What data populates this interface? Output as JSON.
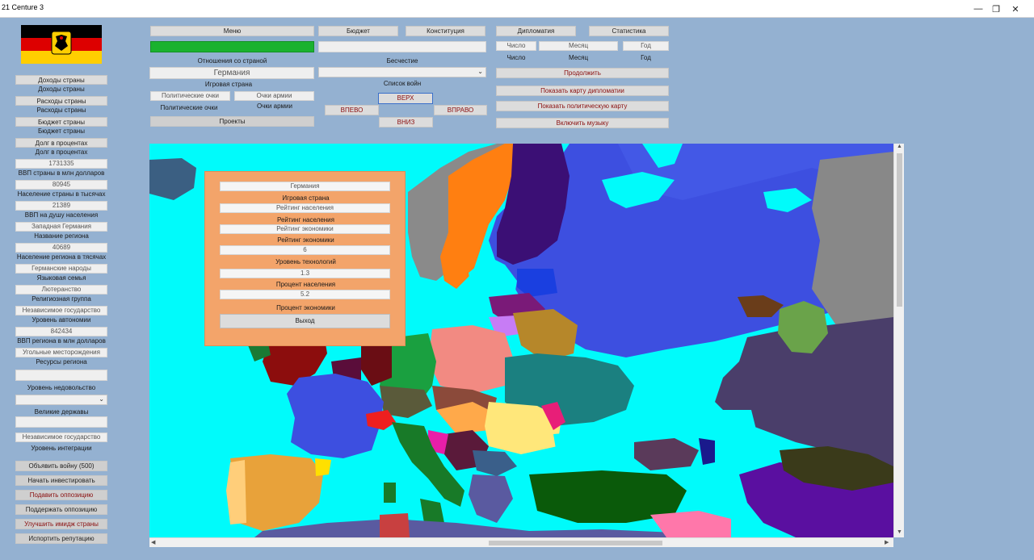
{
  "window": {
    "title": "21 Centure 3",
    "minimize": "—",
    "restore": "❐",
    "close": "✕"
  },
  "colors": {
    "flag": [
      "#000000",
      "#dd0000",
      "#ffce00"
    ],
    "background": "#94b1d1",
    "popup": "#f3a46a",
    "map_water": "#00fbfb"
  },
  "left": {
    "items": [
      {
        "kind": "btn",
        "text": "Доходы страны"
      },
      {
        "kind": "lbl",
        "text": "Доходы страны"
      },
      {
        "kind": "btn",
        "text": "Расходы страны"
      },
      {
        "kind": "lbl",
        "text": "Расходы страны"
      },
      {
        "kind": "btn",
        "text": "Бюджет страны"
      },
      {
        "kind": "lbl",
        "text": "Бюджет страны"
      },
      {
        "kind": "btn",
        "text": "Долг в процентах"
      },
      {
        "kind": "lbl",
        "text": "Долг в процентах"
      },
      {
        "kind": "field",
        "text": "1731335"
      },
      {
        "kind": "lbl",
        "text": "ВВП страны в млн долларов"
      },
      {
        "kind": "field",
        "text": "80945"
      },
      {
        "kind": "lbl",
        "text": "Население страны в тысячах"
      },
      {
        "kind": "field",
        "text": "21389"
      },
      {
        "kind": "lbl",
        "text": "ВВП на душу населения"
      },
      {
        "kind": "field",
        "text": "Западная Германия"
      },
      {
        "kind": "lbl",
        "text": "Название региона"
      },
      {
        "kind": "field",
        "text": "40689"
      },
      {
        "kind": "lbl",
        "text": "Население региона в тясячах"
      },
      {
        "kind": "field",
        "text": "Германские народы"
      },
      {
        "kind": "lbl",
        "text": "Языковая семья"
      },
      {
        "kind": "field",
        "text": "Лютеранство"
      },
      {
        "kind": "lbl",
        "text": "Религиозная группа"
      },
      {
        "kind": "field",
        "text": "Независимое государство"
      },
      {
        "kind": "lbl",
        "text": "Уровень автономии"
      },
      {
        "kind": "field",
        "text": "842434"
      },
      {
        "kind": "lbl",
        "text": "ВВП региона в млн долларов"
      },
      {
        "kind": "field",
        "text": "Угольные месторождения"
      },
      {
        "kind": "lbl",
        "text": "Ресурсы региона"
      }
    ],
    "empty1": "",
    "subsoil_label": "Уровень недовольство",
    "powers_label": "Великие державы",
    "empty2": "",
    "integration_value": "Независимое государство",
    "integration_label": "Уровень интеграции",
    "actions": [
      {
        "text": "Объявить войну (500)",
        "red": false
      },
      {
        "text": "Начать инвестировать",
        "red": false
      },
      {
        "text": "Подавить оппозицию",
        "red": true
      },
      {
        "text": "Поддержать оппозицию",
        "red": false
      },
      {
        "text": "Улучшить имидж страны",
        "red": true
      },
      {
        "text": "Испортить репутацию",
        "red": false
      }
    ]
  },
  "top": {
    "menu": "Меню",
    "relations_label": "Отношения со страной",
    "country": "Германия",
    "playing_country": "Игровая страна",
    "political_points_btn": "Политические очки",
    "army_points_btn": "Очки армии",
    "political_points_lbl": "Политические очки",
    "army_points_lbl": "Очки армии",
    "projects": "Проекты",
    "budget": "Бюджет",
    "constitution": "Конституция",
    "dishonor": "Бесчестие",
    "war_list": "Список войн",
    "up": "ВЕРХ",
    "left": "ВПЕВО",
    "right": "ВПРАВО",
    "down": "ВНИЗ",
    "diplomacy": "Дипломатия",
    "statistics": "Статистика",
    "day_field": "Число",
    "month_field": "Месяц",
    "year_field": "Год",
    "day_lbl": "Число",
    "month_lbl": "Месяц",
    "year_lbl": "Год",
    "continue": "Продолжить",
    "diplomacy_map": "Показать карту дипломатии",
    "political_map": "Показать политическую карту",
    "music": "Включить музыку"
  },
  "popup": {
    "country": "Германия",
    "playing_country": "Игровая страна",
    "pop_rating_field": "Рейтинг населения",
    "pop_rating_lbl": "Рейтинг населения",
    "econ_rating_field": "Рейтинг экономики",
    "econ_rating_lbl": "Рейтинг экономики",
    "econ_rating_value": "6",
    "tech_lbl": "Уровень технологий",
    "tech_value": "1.3",
    "pop_pct_lbl": "Процент населения",
    "pop_pct_value": "5.2",
    "econ_pct_lbl": "Процент экономики",
    "exit": "Выход"
  },
  "scroll": {
    "up": "▲",
    "down": "▼",
    "left": "◀",
    "right": "▶"
  }
}
